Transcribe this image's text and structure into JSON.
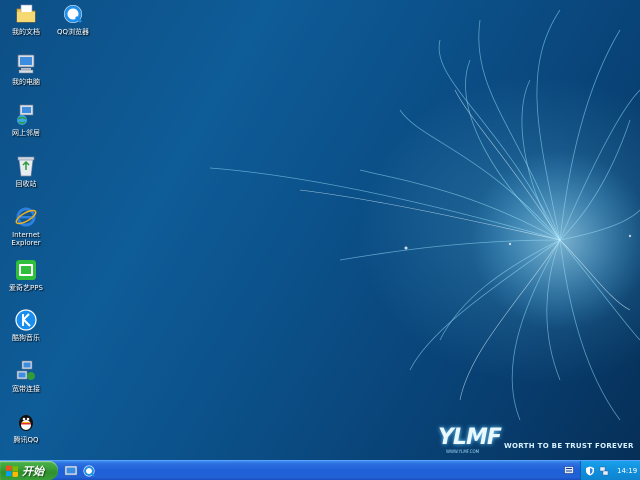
{
  "desktop": {
    "icons": [
      {
        "label": "我的文档",
        "icon": "my-documents-icon"
      },
      {
        "label": "QQ浏览器",
        "icon": "qq-browser-icon"
      },
      {
        "label": "我的电脑",
        "icon": "my-computer-icon"
      },
      {
        "label": "网上邻居",
        "icon": "network-places-icon"
      },
      {
        "label": "回收站",
        "icon": "recycle-bin-icon"
      },
      {
        "label": "Internet\nExplorer",
        "icon": "internet-explorer-icon"
      },
      {
        "label": "爱奇艺PPS",
        "icon": "iqiyi-pps-icon"
      },
      {
        "label": "酷狗音乐",
        "icon": "kugou-music-icon"
      },
      {
        "label": "宽带连接",
        "icon": "broadband-connection-icon"
      },
      {
        "label": "腾讯QQ",
        "icon": "tencent-qq-icon"
      }
    ]
  },
  "wallpaper": {
    "logo": "YLMF",
    "tagline": "WORTH TO BE TRUST FOREVER",
    "url": "WWW.YLMF.COM"
  },
  "taskbar": {
    "start_label": "开始",
    "quick_launch": [
      "show-desktop-icon",
      "qq-browser-icon"
    ],
    "tray_icons": [
      "security-shield-icon",
      "network-icon"
    ],
    "clock": "14:19"
  },
  "colors": {
    "taskbar": "#2262d6",
    "start_button": "#3b9f39",
    "tray": "#118fdc",
    "desktop": "#0e5c98"
  }
}
